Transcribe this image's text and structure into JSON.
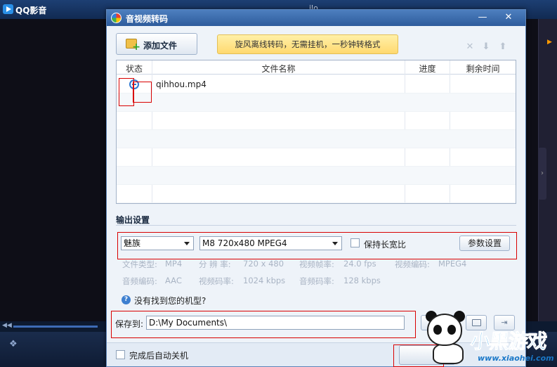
{
  "player": {
    "title": "QQ影音",
    "title_fragment": "ilo"
  },
  "dialog": {
    "title": "音视频转码",
    "controls": {
      "minimize": "—",
      "close": "✕"
    },
    "toolbar": {
      "add_file_label": "添加文件",
      "promo_text": "旋风离线转码，无需挂机，一秒钟转格式",
      "icons": [
        "delete-icon",
        "move-down-icon",
        "move-up-icon"
      ]
    },
    "file_table": {
      "columns": [
        "状态",
        "文件名称",
        "进度",
        "剩余时间"
      ],
      "rows": [
        {
          "status_icon": "pending-icon",
          "name": "qihhou.mp4",
          "progress": "",
          "remaining": ""
        }
      ]
    },
    "output": {
      "section_title": "输出设置",
      "brand_select": "魅族",
      "model_select": "M8 720x480 MPEG4",
      "keep_ratio_label": "保持长宽比",
      "keep_ratio_checked": false,
      "params_button": "参数设置",
      "info_row1": [
        {
          "label": "文件类型:",
          "value": "MP4"
        },
        {
          "label": "分 辨 率:",
          "value": "720 x 480"
        },
        {
          "label": "视频帧率:",
          "value": "24.0 fps"
        },
        {
          "label": "视频编码:",
          "value": "MPEG4"
        }
      ],
      "info_row2": [
        {
          "label": "音频编码:",
          "value": "AAC"
        },
        {
          "label": "视频码率:",
          "value": "1024 kbps"
        },
        {
          "label": "音频码率:",
          "value": "128 kbps"
        }
      ],
      "help_text": "没有找到您的机型?"
    },
    "save": {
      "label": "保存到:",
      "path": "D:\\My Documents\\",
      "browse_label": "浏览"
    },
    "footer": {
      "shutdown_label": "完成后自动关机",
      "shutdown_checked": false,
      "start_label": ""
    }
  },
  "watermark": {
    "logo_text": "小黑游戏",
    "url": "www.xiaohei.com"
  },
  "colors": {
    "titlebar": "#2e5c9c",
    "highlight_box": "#d90000",
    "promo_bg": "#ffd970"
  }
}
